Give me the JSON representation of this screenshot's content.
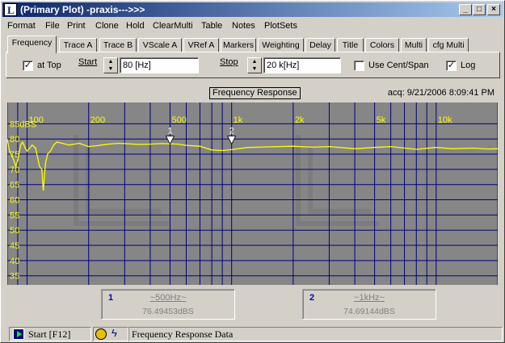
{
  "window": {
    "title": "(Primary Plot) -praxis--->>>",
    "controls": {
      "minimize": "_",
      "maximize": "□",
      "close": "×"
    }
  },
  "menu": [
    "Format",
    "File",
    "Print",
    "Clone",
    "Hold",
    "ClearMulti",
    "Table",
    "Notes",
    "PlotSets"
  ],
  "tabs": [
    "Frequency",
    "Trace A",
    "Trace B",
    "VScale A",
    "VRef A",
    "Markers",
    "Weighting",
    "Delay",
    "Title",
    "Colors",
    "Multi",
    "cfg Multi"
  ],
  "active_tab": "Frequency",
  "frequency_panel": {
    "at_top": {
      "label": "at Top",
      "checked": true
    },
    "start": {
      "label": "Start",
      "value": "80 [Hz]"
    },
    "stop": {
      "label": "Stop",
      "value": "20 k[Hz]"
    },
    "use_cent_span": {
      "label": "Use Cent/Span",
      "checked": false
    },
    "log": {
      "label": "Log",
      "checked": true
    }
  },
  "plot": {
    "title": "Frequency Response",
    "acquired": "acq: 9/21/2006 8:09:41 PM",
    "unit_label": "dBS",
    "trace_color": "#ffff00",
    "grid_color": "#000080",
    "label_color": "#ffff00",
    "background_color": "#868686"
  },
  "chart_data": {
    "type": "line",
    "xscale": "log",
    "xlim": [
      80,
      20000
    ],
    "ylim": [
      32,
      92
    ],
    "x_tick_labels": [
      {
        "x": 100,
        "label": "100"
      },
      {
        "x": 200,
        "label": "200"
      },
      {
        "x": 500,
        "label": "500"
      },
      {
        "x": 1000,
        "label": "1k"
      },
      {
        "x": 2000,
        "label": "2k"
      },
      {
        "x": 5000,
        "label": "5k"
      },
      {
        "x": 10000,
        "label": "10k"
      }
    ],
    "y_ticks": [
      85,
      80,
      75,
      70,
      65,
      60,
      55,
      50,
      45,
      40,
      35
    ],
    "ylabel": "dBS",
    "series": [
      {
        "x": [
          80,
          82,
          85,
          88,
          90,
          93,
          95,
          98,
          100,
          103,
          106,
          110,
          115,
          118,
          120,
          123,
          126,
          130,
          135,
          140,
          150,
          160,
          170,
          180,
          190,
          200,
          220,
          250,
          280,
          300,
          350,
          400,
          450,
          500,
          550,
          600,
          700,
          800,
          900,
          1000,
          1200,
          1500,
          2000,
          2500,
          3000,
          4000,
          5000,
          6000,
          7000,
          8000,
          10000,
          12000,
          15000,
          18000,
          20000
        ],
        "y": [
          80,
          76,
          74,
          71,
          73,
          78,
          79,
          77,
          76,
          77,
          78,
          77,
          71,
          70,
          63,
          72,
          75,
          76,
          78,
          79,
          78.5,
          78,
          78.3,
          78.6,
          78,
          77.5,
          77.8,
          78.3,
          78.6,
          78.5,
          78.2,
          78.3,
          78.5,
          78.4,
          78.3,
          77.9,
          77.6,
          76.4,
          76.2,
          76.5,
          77.2,
          77.4,
          77.6,
          77.3,
          77.5,
          76.8,
          77.2,
          77.5,
          77.0,
          76.6,
          77.2,
          76.8,
          77.0,
          76.7,
          76.8
        ]
      }
    ],
    "markers": [
      {
        "id": "1",
        "x": 500,
        "y": 76.49453
      },
      {
        "id": "2",
        "x": 1000,
        "y": 74.69144
      }
    ]
  },
  "marker_readouts": [
    {
      "num": "1",
      "freq": "~500Hz~",
      "value": "76.49453dBS"
    },
    {
      "num": "2",
      "freq": "~1kHz~",
      "value": "74.69144dBS"
    }
  ],
  "status": {
    "start_label": "Start [F12]",
    "status_text": "Frequency Response Data"
  }
}
